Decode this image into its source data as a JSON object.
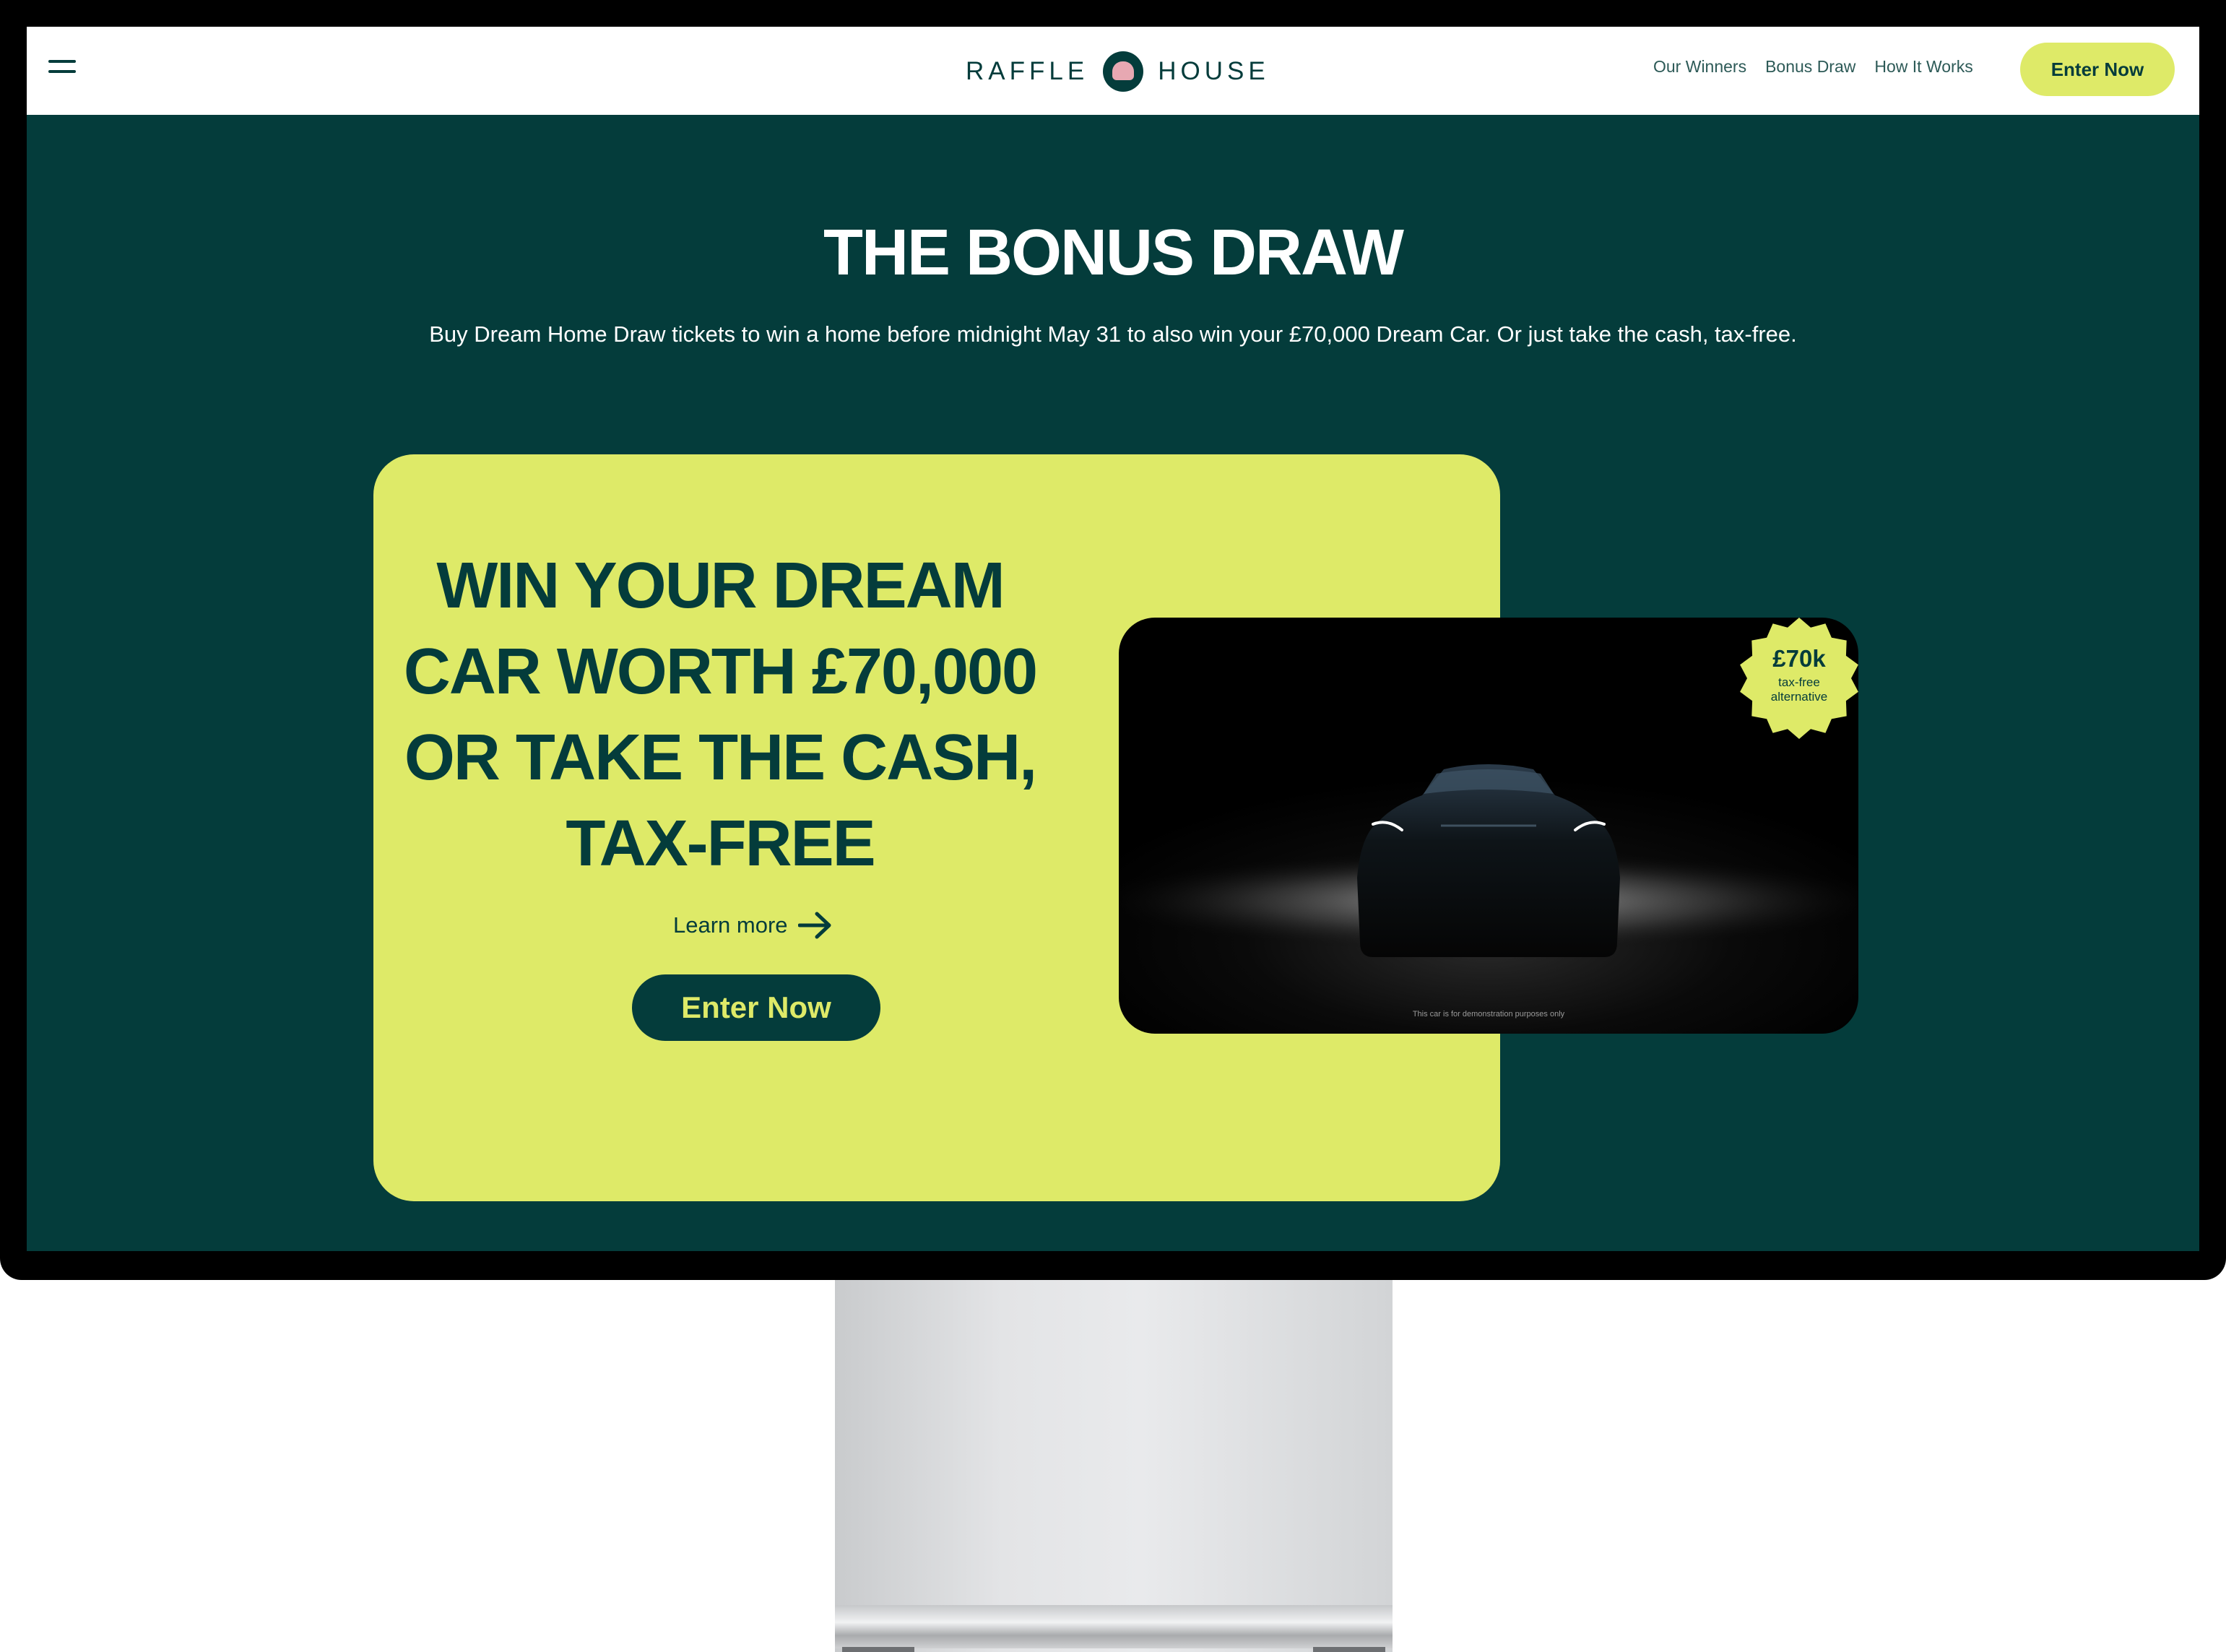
{
  "nav": {
    "logo_left": "RAFFLE",
    "logo_right": "HOUSE",
    "links": [
      "Our Winners",
      "Bonus Draw",
      "How It Works"
    ],
    "enter_label": "Enter Now"
  },
  "hero": {
    "title": "THE BONUS DRAW",
    "subtitle": "Buy Dream Home Draw tickets to win a home before midnight May 31 to also win your £70,000 Dream Car. Or just take the cash, tax-free."
  },
  "promo": {
    "headline": "WIN YOUR DREAM CAR WORTH £70,000 OR TAKE THE CASH, TAX-FREE",
    "learn_more": "Learn more",
    "enter_label": "Enter Now"
  },
  "car": {
    "disclaimer": "This car is for demonstration purposes only",
    "badge_amount": "£70k",
    "badge_label": "tax-free alternative"
  },
  "colors": {
    "brand_dark": "#043c3b",
    "accent_lime": "#deea68",
    "logo_pink": "#e7a8b2"
  },
  "icons": [
    "hamburger-menu-icon",
    "logo-mark-icon",
    "arrow-right-icon",
    "sunburst-badge-icon"
  ]
}
